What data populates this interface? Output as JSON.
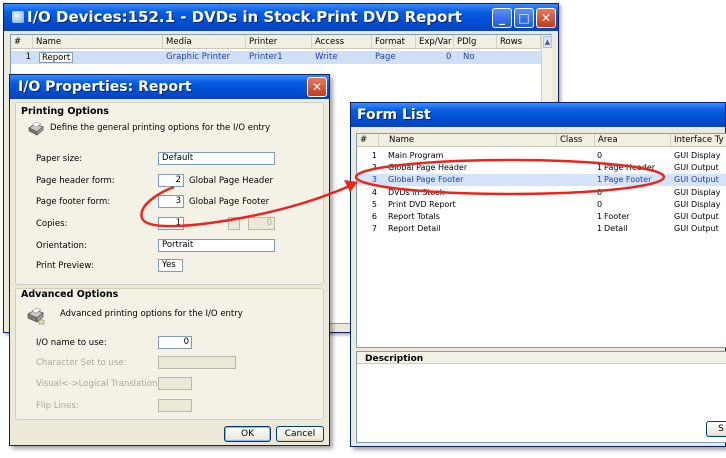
{
  "io_devices": {
    "title": "I/O Devices:152.1 -  DVDs in Stock.Print DVD Report",
    "columns": [
      "#",
      "Name",
      "Media",
      "Printer",
      "Access",
      "Format",
      "Exp/Var",
      "PDlg",
      "Rows"
    ],
    "rows": [
      {
        "num": "1",
        "name": "Report",
        "media": "Graphic Printer",
        "printer": "Printer1",
        "access": "Write",
        "format": "Page",
        "expvar": "0",
        "pdlg": "No",
        "rows": ""
      }
    ],
    "buttons": {
      "minimize": "_",
      "maximize": "□",
      "close": "✕"
    }
  },
  "io_properties": {
    "title": "I/O Properties: Report",
    "printing_options": {
      "heading": "Printing Options",
      "description": "Define the general printing options for the I/O entry",
      "paper_size_label": "Paper size:",
      "paper_size_value": "Default",
      "page_header_label": "Page header form:",
      "page_header_num": "2",
      "page_header_text": "Global Page Header",
      "page_footer_label": "Page footer form:",
      "page_footer_num": "3",
      "page_footer_text": "Global Page Footer",
      "copies_label": "Copies:",
      "copies_value": "1",
      "copies_disabled_value": "0",
      "orientation_label": "Orientation:",
      "orientation_value": "Portrait",
      "print_preview_label": "Print Preview:",
      "print_preview_value": "Yes"
    },
    "advanced_options": {
      "heading": "Advanced Options",
      "description": "Advanced printing options for the I/O entry",
      "io_name_label": "I/O name to use:",
      "io_name_value": "0",
      "charset_label": "Character Set to use:",
      "visual_label": "Visual<->Logical Translation:",
      "flip_label": "Flip Lines:"
    },
    "ok_label": "OK",
    "cancel_label": "Cancel"
  },
  "form_list": {
    "title": "Form List",
    "columns": [
      "#",
      "Name",
      "Class",
      "Area",
      "Interface Ty"
    ],
    "rows": [
      {
        "num": "1",
        "name": "Main Program",
        "class": "0",
        "area": "",
        "iface": "GUI Display"
      },
      {
        "num": "2",
        "name": "Global Page Header",
        "class": "1",
        "area": "Page Header",
        "iface": "GUI Output"
      },
      {
        "num": "3",
        "name": "Global Page Footer",
        "class": "1",
        "area": "Page Footer",
        "iface": "GUI Output"
      },
      {
        "num": "4",
        "name": "DVDs in Stock",
        "class": "0",
        "area": "",
        "iface": "GUI Display"
      },
      {
        "num": "5",
        "name": "Print DVD Report",
        "class": "0",
        "area": "",
        "iface": "GUI Display"
      },
      {
        "num": "6",
        "name": "Report Totals",
        "class": "1",
        "area": "Footer",
        "iface": "GUI Output"
      },
      {
        "num": "7",
        "name": "Report Detail",
        "class": "1",
        "area": "Detail",
        "iface": "GUI Output"
      }
    ],
    "description_label": "Description",
    "button_fragment": "S"
  },
  "colors": {
    "annotation_red": "#e8261c",
    "xp_blue": "#0050d8",
    "selection": "#d4e3f7"
  }
}
